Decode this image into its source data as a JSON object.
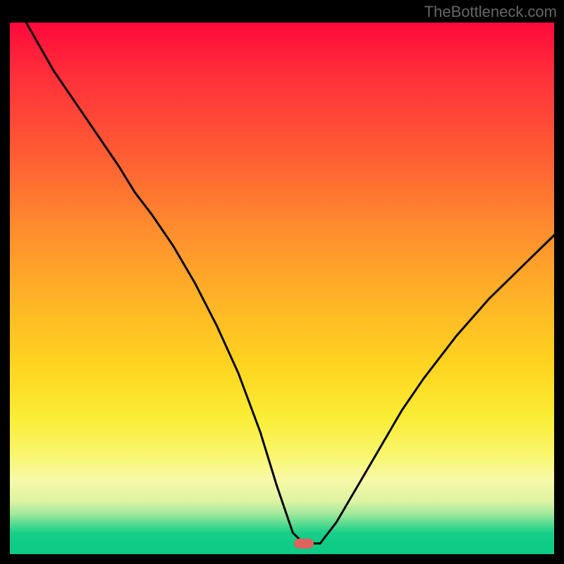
{
  "watermark": "TheBottleneck.com",
  "colors": {
    "background": "#000000",
    "curve": "#000000",
    "marker": "#e0615e",
    "gradient_top": "#ff0a3c",
    "gradient_bottom": "#0ecb86"
  },
  "chart_data": {
    "type": "line",
    "title": "",
    "xlabel": "",
    "ylabel": "",
    "xlim": [
      0,
      100
    ],
    "ylim": [
      0,
      100
    ],
    "annotations": [
      {
        "type": "marker",
        "label": "optimal-point",
        "x": 54,
        "y": 2
      }
    ],
    "series": [
      {
        "name": "bottleneck-curve",
        "x": [
          3,
          8,
          14,
          20,
          23,
          26,
          30,
          34,
          38,
          42,
          46,
          49,
          52,
          54,
          57,
          60,
          64,
          68,
          72,
          76,
          82,
          88,
          94,
          100
        ],
        "values": [
          100,
          91,
          82,
          73,
          68,
          64,
          58,
          51,
          43,
          34,
          23,
          13,
          4,
          2,
          2,
          6,
          13,
          20,
          27,
          33,
          41,
          48,
          54,
          60
        ]
      }
    ]
  }
}
